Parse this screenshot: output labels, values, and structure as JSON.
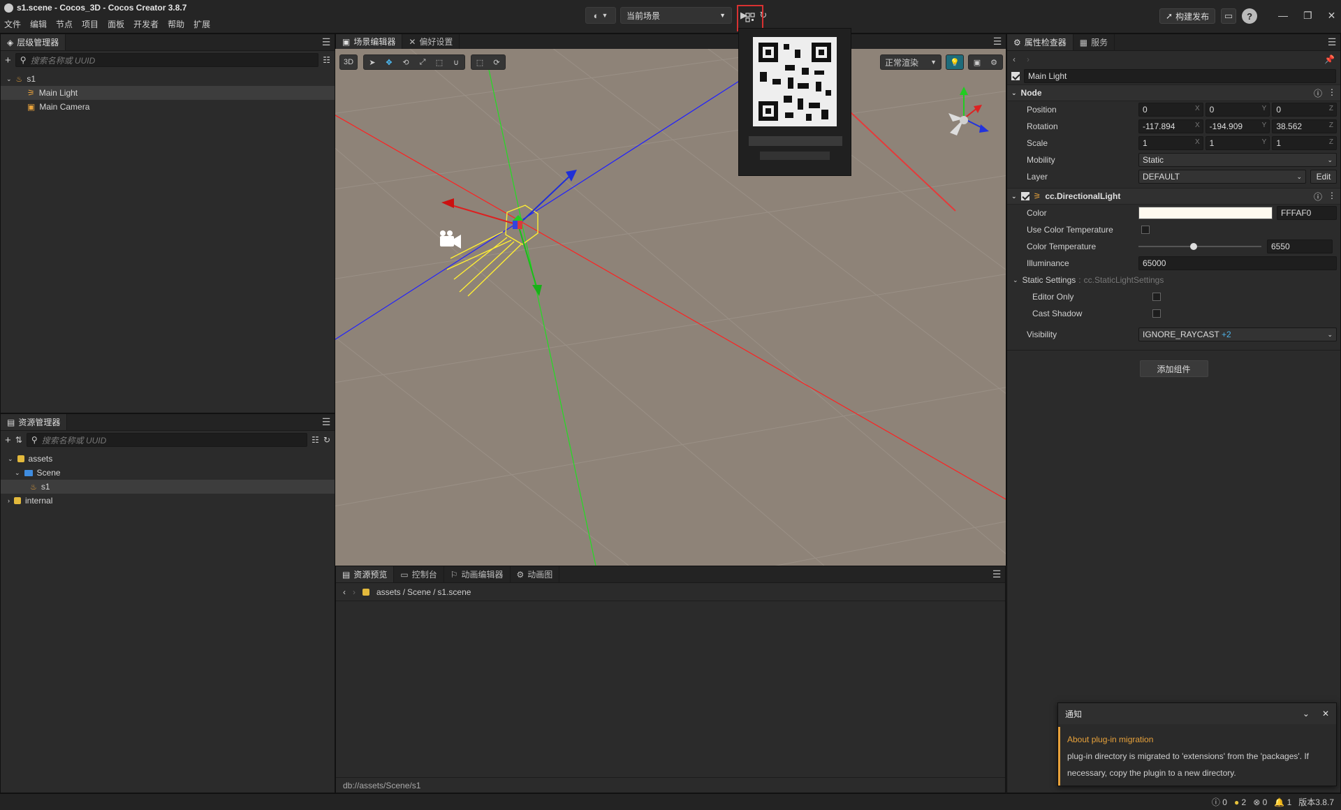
{
  "window": {
    "title": "s1.scene - Cocos_3D - Cocos Creator 3.8.7"
  },
  "menu": [
    "文件",
    "编辑",
    "节点",
    "项目",
    "面板",
    "开发者",
    "帮助",
    "扩展"
  ],
  "toolbar": {
    "scene_select": "当前场景",
    "publish": "构建发布"
  },
  "hierarchy": {
    "tab": "层级管理器",
    "search_placeholder": "搜索名称或 UUID",
    "items": [
      {
        "label": "s1"
      },
      {
        "label": "Main Light"
      },
      {
        "label": "Main Camera"
      }
    ]
  },
  "assets": {
    "tab": "资源管理器",
    "search_placeholder": "搜索名称或 UUID",
    "items": [
      {
        "label": "assets"
      },
      {
        "label": "Scene"
      },
      {
        "label": "s1"
      },
      {
        "label": "internal"
      }
    ]
  },
  "scene_editor": {
    "tabs": [
      "场景编辑器",
      "偏好设置"
    ],
    "mode_3d": "3D",
    "render_mode": "正常渲染"
  },
  "bottom": {
    "tabs": [
      "资源预览",
      "控制台",
      "动画编辑器",
      "动画图"
    ],
    "breadcrumb": [
      "assets",
      "Scene",
      "s1.scene"
    ],
    "status_path": "db://assets/Scene/s1"
  },
  "inspector": {
    "tabs": [
      "属性检查器",
      "服务"
    ],
    "node_name": "Main Light",
    "node_section": "Node",
    "position": {
      "label": "Position",
      "x": "0",
      "y": "0",
      "z": "0"
    },
    "rotation": {
      "label": "Rotation",
      "x": "-117.894",
      "y": "-194.909",
      "z": "38.562"
    },
    "scale": {
      "label": "Scale",
      "x": "1",
      "y": "1",
      "z": "1"
    },
    "mobility": {
      "label": "Mobility",
      "value": "Static"
    },
    "layer": {
      "label": "Layer",
      "value": "DEFAULT",
      "edit": "Edit"
    },
    "component": "cc.DirectionalLight",
    "color": {
      "label": "Color",
      "value": "FFFAF0",
      "swatch": "#FFFAF0"
    },
    "use_color_temp": {
      "label": "Use Color Temperature"
    },
    "color_temp": {
      "label": "Color Temperature",
      "value": "6550",
      "slider_fraction": 0.45
    },
    "illuminance": {
      "label": "Illuminance",
      "value": "65000"
    },
    "static_settings": {
      "label": "Static Settings",
      "type": "cc.StaticLightSettings"
    },
    "editor_only": {
      "label": "Editor Only"
    },
    "cast_shadow": {
      "label": "Cast Shadow"
    },
    "visibility": {
      "label": "Visibility",
      "value": "IGNORE_RAYCAST",
      "extra": "+2"
    },
    "add_component": "添加组件",
    "axis": {
      "x": "X",
      "y": "Y",
      "z": "Z"
    }
  },
  "notification": {
    "title": "通知",
    "heading": "About plug-in migration",
    "body": "plug-in directory is migrated to 'extensions' from the 'packages'. If necessary, copy the plugin to a new directory."
  },
  "status": {
    "info": "0",
    "warn": "2",
    "error": "0",
    "bell": "1",
    "version": "版本3.8.7"
  },
  "colors": {
    "accent_orange": "#E8A23B",
    "highlight_red": "#D83131",
    "viewport_bg": "#8E8378"
  }
}
